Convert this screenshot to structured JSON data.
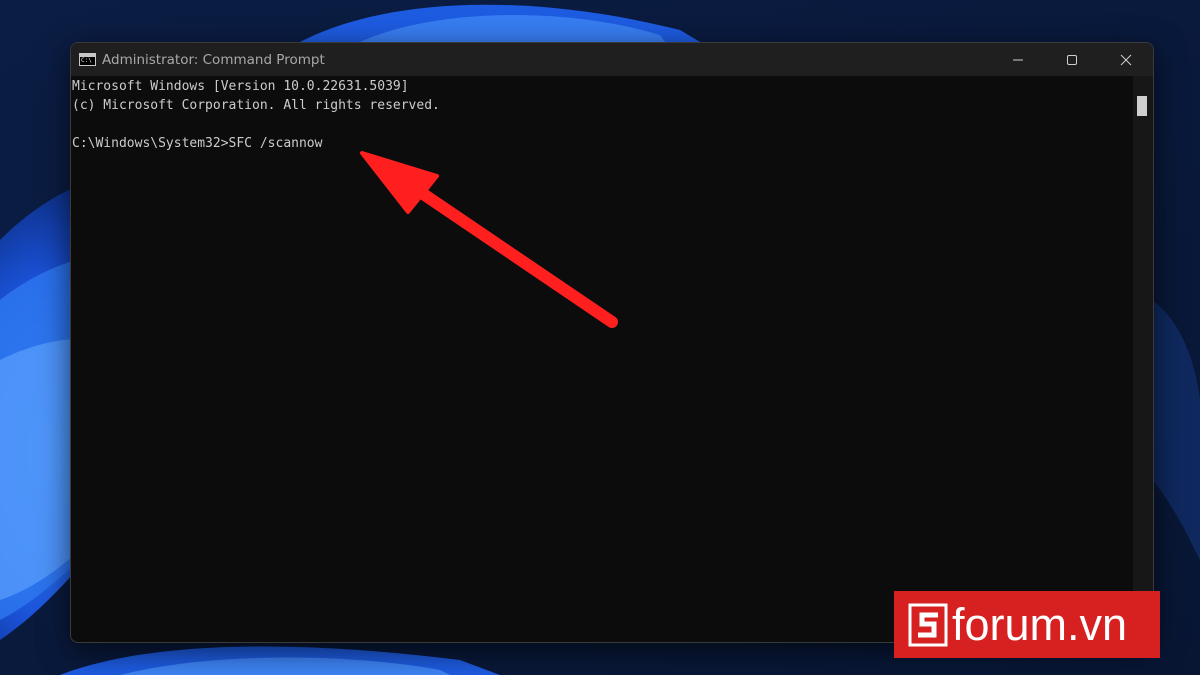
{
  "window": {
    "title": "Administrator: Command Prompt",
    "app_icon_text": "C:\\",
    "controls": {
      "minimize": "minimize-icon",
      "maximize": "maximize-icon",
      "close": "close-icon"
    }
  },
  "terminal": {
    "lines": [
      "Microsoft Windows [Version 10.0.22631.5039]",
      "(c) Microsoft Corporation. All rights reserved.",
      "",
      "C:\\Windows\\System32>SFC /scannow"
    ]
  },
  "annotation": {
    "arrow_color": "#ff1f1f"
  },
  "watermark": {
    "letter_mark": "S",
    "text": "forum.vn",
    "background": "#d72121"
  },
  "colors": {
    "terminal_bg": "#0c0c0c",
    "terminal_text": "#cccccc",
    "titlebar_bg": "#1f1f1f"
  }
}
